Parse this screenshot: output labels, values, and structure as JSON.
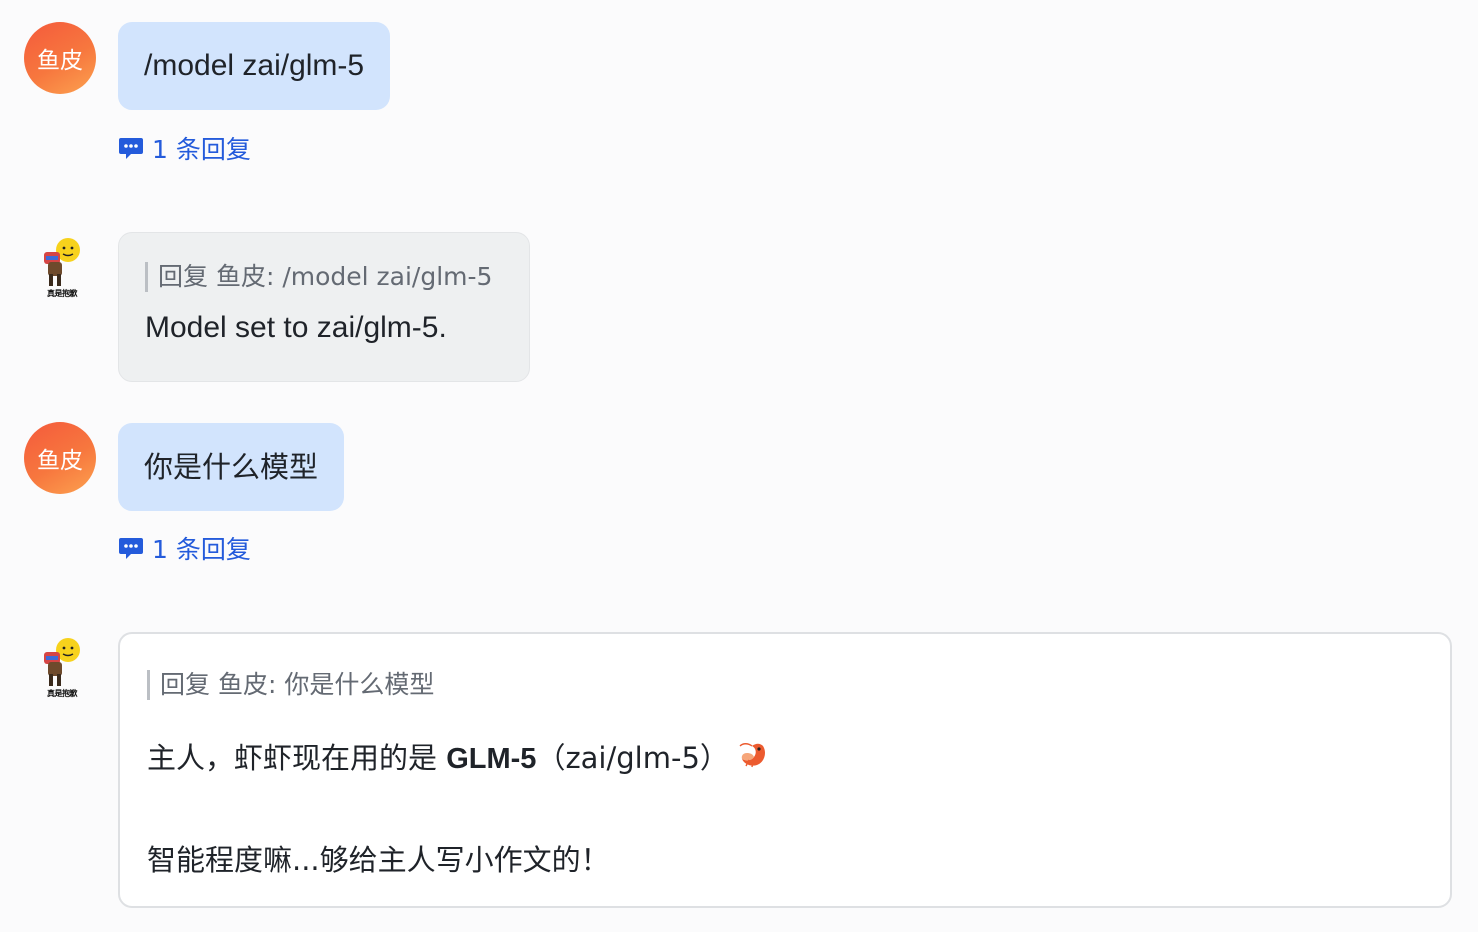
{
  "user": {
    "avatar_text": "鱼皮"
  },
  "bot": {
    "avatar_caption": "真是抱歉"
  },
  "messages": [
    {
      "user_text": "/model zai/glm-5",
      "reply_count": "1 条回复",
      "bot_quote": "回复 鱼皮: /model zai/glm-5",
      "bot_text": "Model set to zai/glm-5."
    },
    {
      "user_text": "你是什么模型",
      "reply_count": "1 条回复",
      "bot_quote": "回复 鱼皮: 你是什么模型",
      "bot_line1_prefix": "主人，虾虾现在用的是 ",
      "bot_line1_bold": "GLM-5",
      "bot_line1_suffix": "（zai/glm-5）",
      "bot_line1_emoji": "shrimp-icon",
      "bot_line2": "智能程度嘛...够给主人写小作文的！"
    }
  ],
  "colors": {
    "user_bubble": "#d2e4fd",
    "bot_bubble": "#eef0f1",
    "link": "#245bdb",
    "avatar_gradient_start": "#f45a3c",
    "avatar_gradient_end": "#fca250"
  }
}
